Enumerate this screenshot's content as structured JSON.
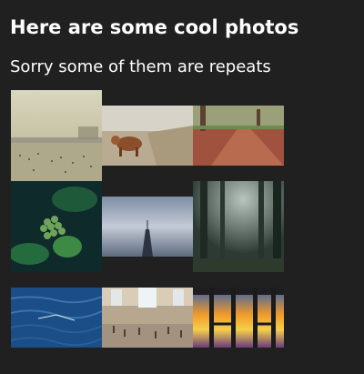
{
  "page": {
    "title": "Here are some cool photos",
    "subtitle": "Sorry some of them are repeats"
  },
  "photos": [
    {
      "name": "beach-crowd-photo"
    },
    {
      "name": "highland-cow-photo"
    },
    {
      "name": "autumn-path-photo"
    },
    {
      "name": "green-plant-buds-photo"
    },
    {
      "name": "skyscraper-photo"
    },
    {
      "name": "misty-forest-photo"
    },
    {
      "name": "ocean-water-photo"
    },
    {
      "name": "station-hall-photo"
    },
    {
      "name": "pier-sunset-photo"
    }
  ],
  "colors": {
    "background": "#202020",
    "text": "#ffffff"
  }
}
